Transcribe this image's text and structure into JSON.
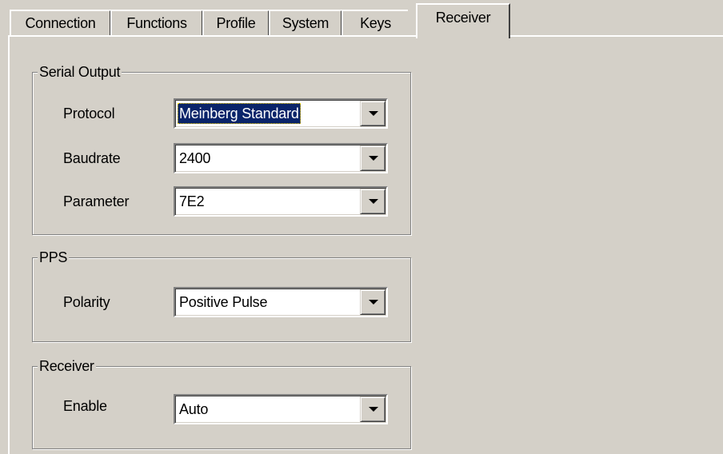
{
  "tabs": [
    {
      "label": "Connection"
    },
    {
      "label": "Functions"
    },
    {
      "label": "Profile"
    },
    {
      "label": "System"
    },
    {
      "label": "Keys"
    },
    {
      "label": "Receiver"
    }
  ],
  "selected_tab": "Receiver",
  "serial_output": {
    "title": "Serial Output",
    "protocol": {
      "label": "Protocol",
      "value": "Meinberg Standard"
    },
    "baudrate": {
      "label": "Baudrate",
      "value": "2400"
    },
    "parameter": {
      "label": "Parameter",
      "value": "7E2"
    }
  },
  "pps": {
    "title": "PPS",
    "polarity": {
      "label": "Polarity",
      "value": "Positive Pulse"
    }
  },
  "receiver": {
    "title": "Receiver",
    "enable": {
      "label": "Enable",
      "value": "Auto"
    }
  },
  "icons": {
    "dropdown": "chevron-down-icon"
  },
  "colors": {
    "background": "#d4d0c8",
    "selection": "#0a246a",
    "selection_text": "#ffffff"
  }
}
